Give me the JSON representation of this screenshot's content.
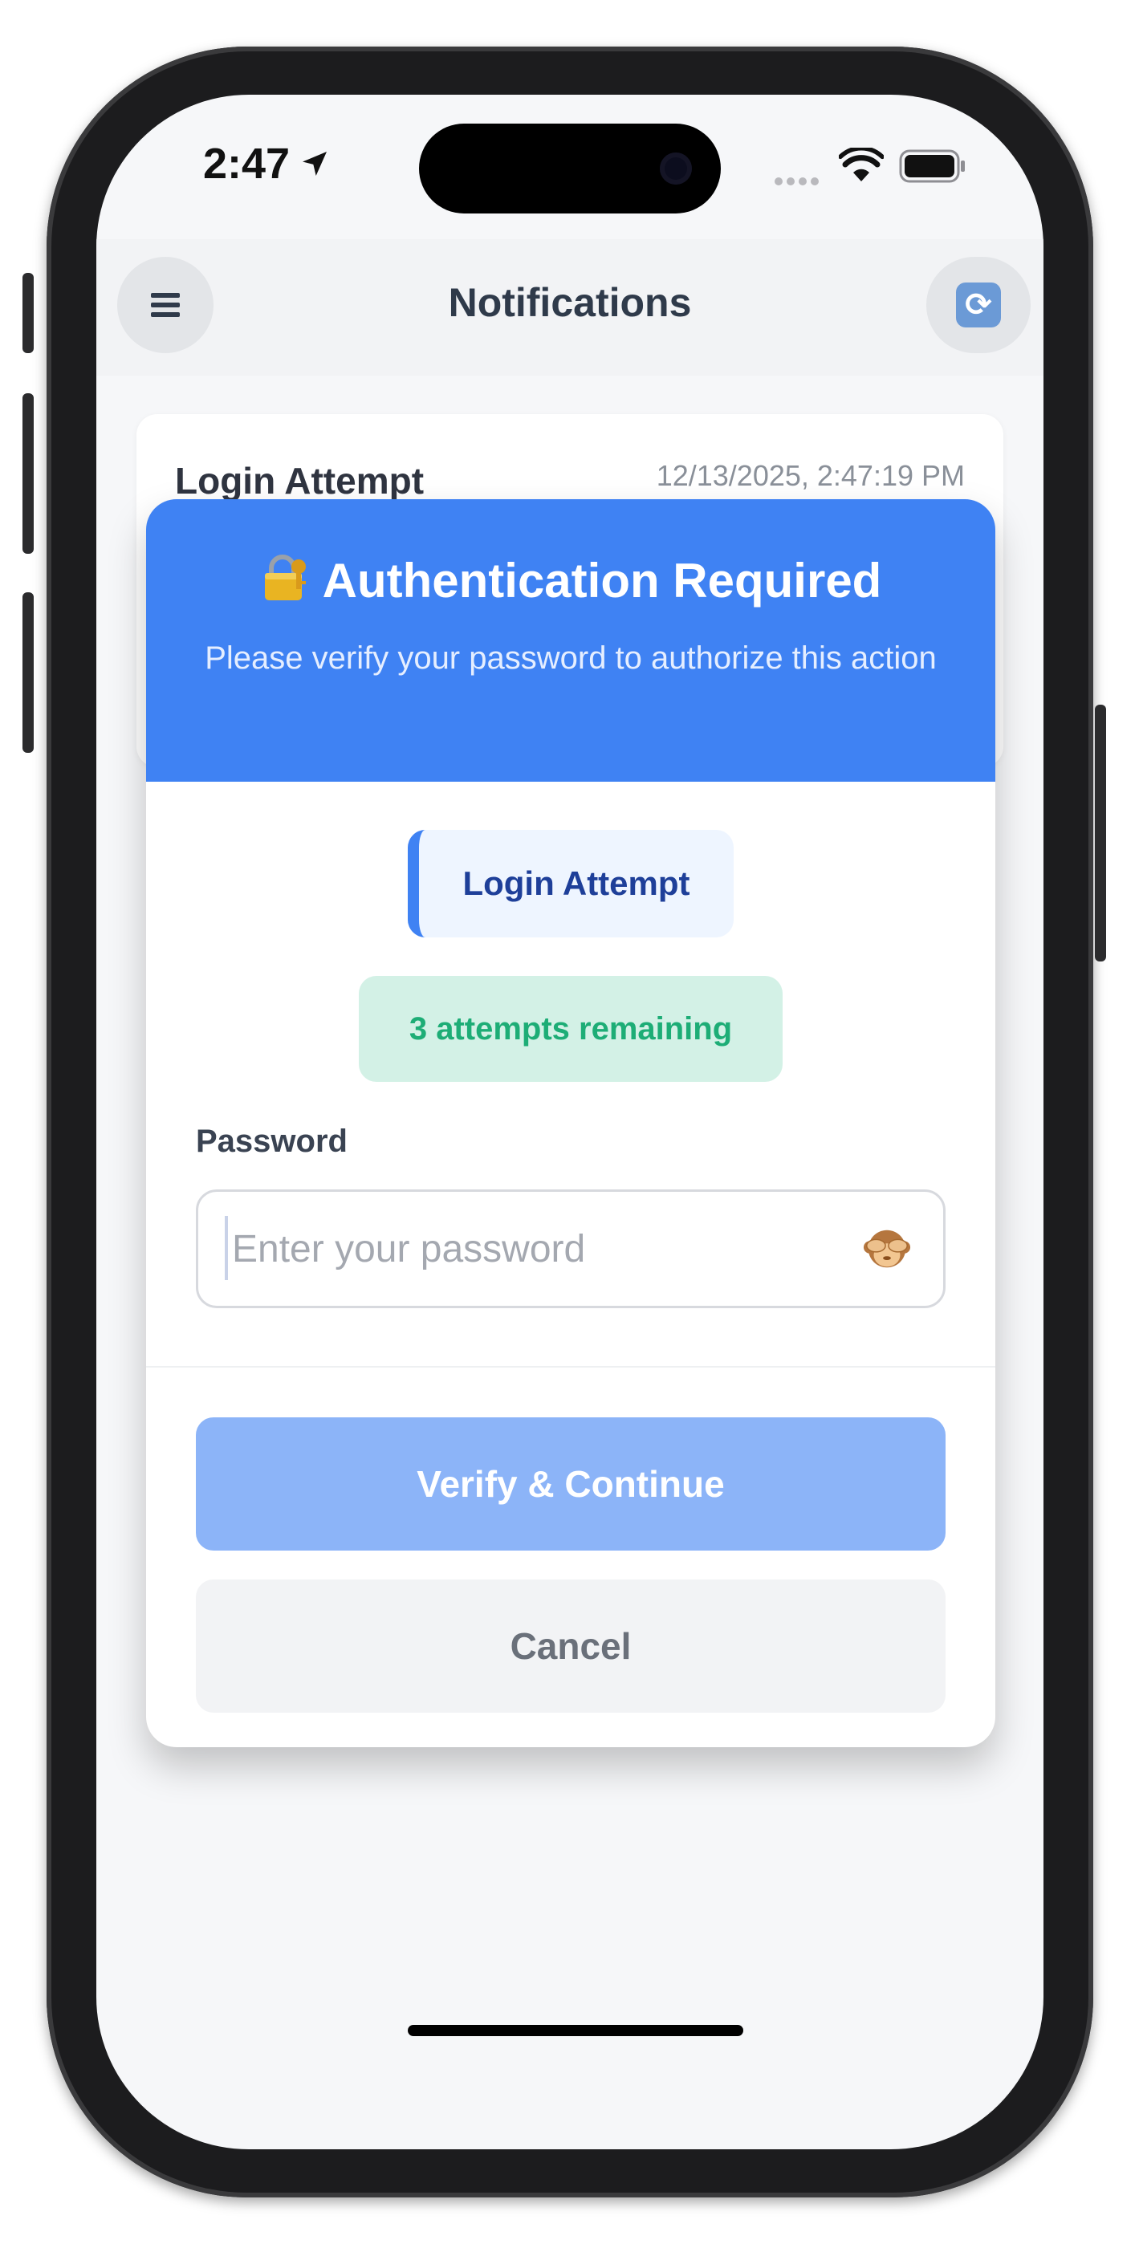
{
  "status_bar": {
    "time": "2:47",
    "icons": [
      "location-arrow-icon",
      "signal-dots-icon",
      "wifi-icon",
      "battery-icon"
    ]
  },
  "header": {
    "title": "Notifications",
    "menu_icon": "hamburger-menu-icon",
    "refresh_icon": "refresh-icon"
  },
  "notification_card": {
    "title": "Login Attempt",
    "timestamp": "12/13/2025, 2:47:19 PM"
  },
  "modal": {
    "title": "Authentication Required",
    "title_icon": "lock-with-key-icon",
    "subtitle": "Please verify your password to authorize this action",
    "context_tag": "Login Attempt",
    "attempts_text": "3 attempts remaining",
    "password_label": "Password",
    "password_value": "",
    "password_placeholder": "Enter your password",
    "toggle_visibility_icon": "see-no-evil-monkey-icon",
    "verify_label": "Verify & Continue",
    "cancel_label": "Cancel"
  },
  "colors": {
    "primary": "#3f82f3",
    "primary_disabled": "#8cb4f8",
    "success_text": "#1dad76",
    "success_bg": "#d3f1e6",
    "tag_text": "#1e3f99",
    "tag_bg": "#eef5ff"
  }
}
